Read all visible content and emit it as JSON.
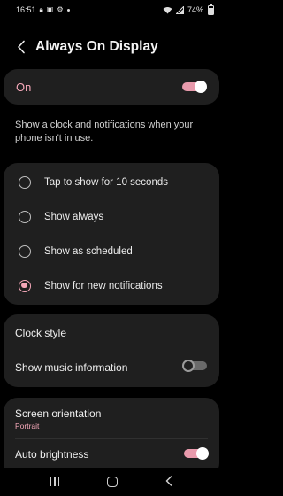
{
  "status_bar": {
    "time": "16:51",
    "battery": "74%",
    "battery_level": 0.74
  },
  "header": {
    "title": "Always On Display"
  },
  "master_switch": {
    "label": "On",
    "enabled": true
  },
  "description": "Show a clock and notifications when your phone isn't in use.",
  "display_mode": {
    "options": [
      {
        "label": "Tap to show for 10 seconds",
        "selected": false
      },
      {
        "label": "Show always",
        "selected": false
      },
      {
        "label": "Show as scheduled",
        "selected": false
      },
      {
        "label": "Show for new notifications",
        "selected": true
      }
    ]
  },
  "clock_style": {
    "label": "Clock style"
  },
  "music_info": {
    "label": "Show music information",
    "enabled": false
  },
  "screen_orientation": {
    "label": "Screen orientation",
    "value": "Portrait"
  },
  "auto_brightness": {
    "label": "Auto brightness",
    "enabled": true
  },
  "colors": {
    "accent": "#f4a7b8",
    "card_bg": "#1f1f1f",
    "background": "#000000"
  }
}
